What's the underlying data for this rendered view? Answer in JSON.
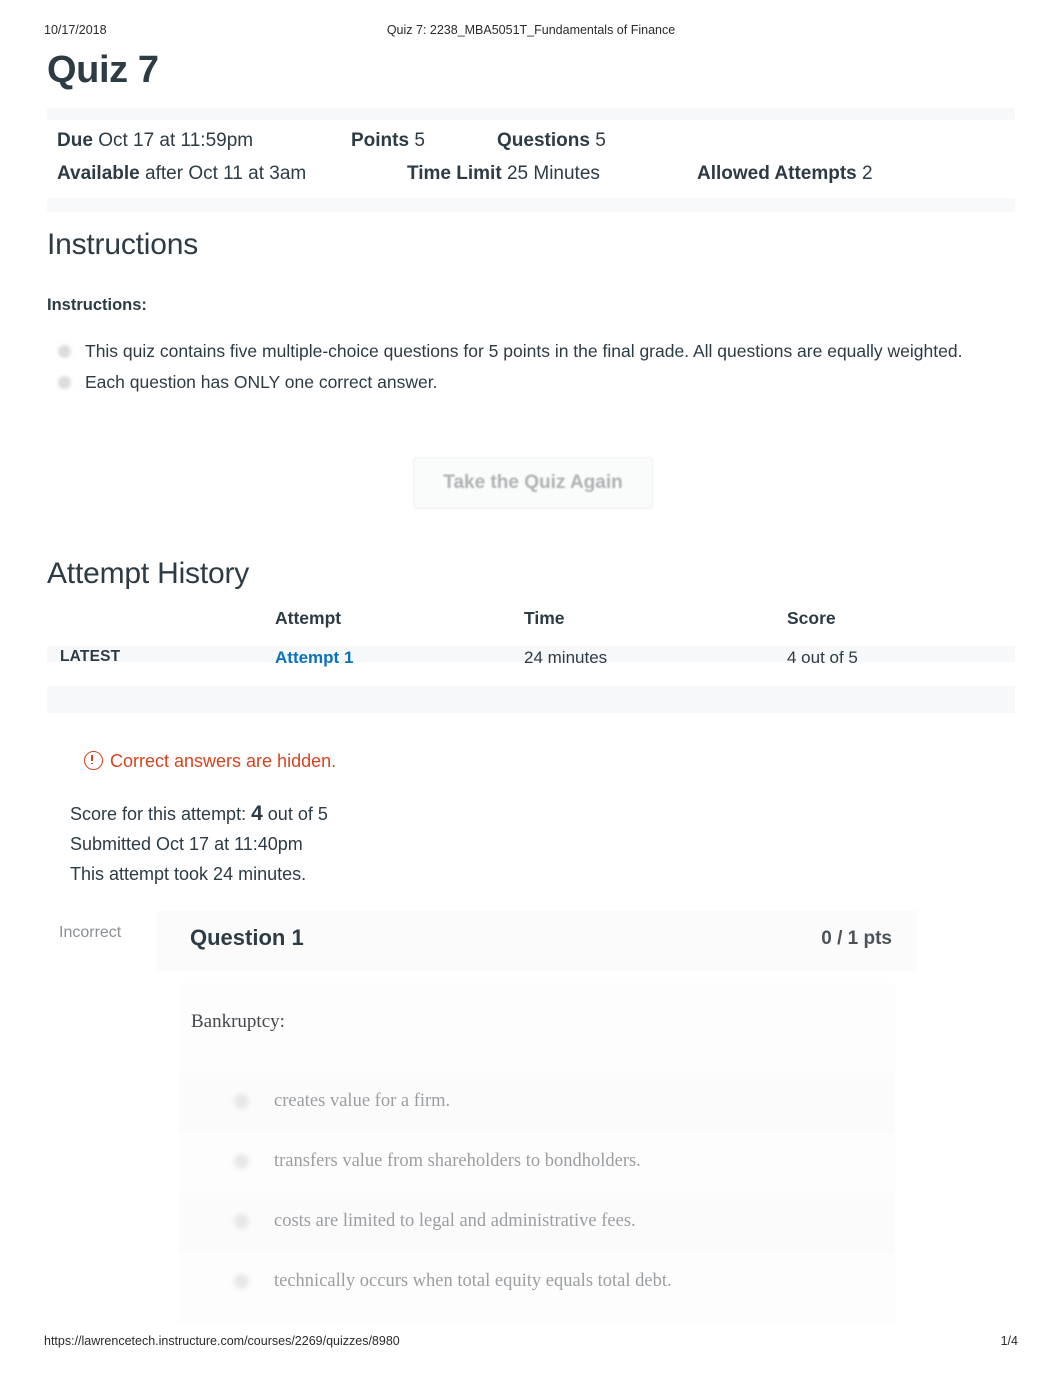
{
  "print_header": {
    "date": "10/17/2018",
    "title": "Quiz 7: 2238_MBA5051T_Fundamentals of Finance"
  },
  "print_footer": {
    "url": "https://lawrencetech.instructure.com/courses/2269/quizzes/8980",
    "page": "1/4"
  },
  "quiz": {
    "title": "Quiz 7",
    "meta": {
      "due_label": "Due",
      "due_value": "Oct 17 at 11:59pm",
      "points_label": "Points",
      "points_value": "5",
      "questions_label": "Questions",
      "questions_value": "5",
      "available_label": "Available",
      "available_value": "after Oct 11 at 3am",
      "time_limit_label": "Time Limit",
      "time_limit_value": "25 Minutes",
      "allowed_attempts_label": "Allowed Attempts",
      "allowed_attempts_value": "2"
    }
  },
  "instructions": {
    "heading": "Instructions",
    "label": "Instructions:",
    "items": [
      "This quiz contains five multiple-choice questions for 5 points in the final grade. All questions are equally weighted.",
      "Each question has ONLY one correct answer."
    ]
  },
  "actions": {
    "take_again": "Take the Quiz Again"
  },
  "attempt_history": {
    "heading": "Attempt History",
    "columns": [
      "",
      "Attempt",
      "Time",
      "Score"
    ],
    "rows": [
      {
        "marker": "LATEST",
        "attempt": "Attempt 1",
        "time": "24 minutes",
        "score": "4 out of 5"
      }
    ]
  },
  "notice": {
    "icon": "exclamation-circle-icon",
    "text": "Correct answers are hidden.",
    "color": "#d4451f"
  },
  "attempt_summary": {
    "score_prefix": "Score for this attempt:",
    "score_value": "4",
    "score_suffix": "out of 5",
    "submitted": "Submitted Oct 17 at 11:40pm",
    "duration": "This attempt took 24 minutes."
  },
  "question": {
    "status": "Incorrect",
    "title": "Question 1",
    "points": "0 / 1 pts",
    "prompt": "Bankruptcy:",
    "answers": [
      "creates value for a firm.",
      "transfers value from shareholders to bondholders.",
      "costs are limited to legal and administrative fees.",
      "technically occurs when total equity equals total debt."
    ]
  },
  "colors": {
    "link": "#0b72ba",
    "warning": "#d4451f",
    "text": "#2d3b45",
    "muted": "#8b8f93"
  }
}
